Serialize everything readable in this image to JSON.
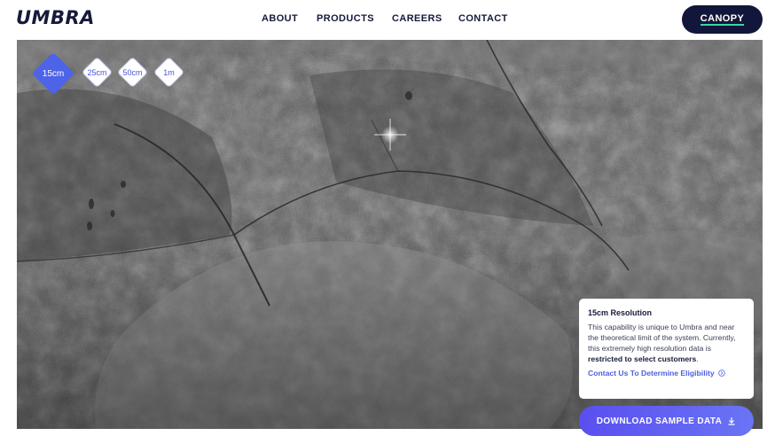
{
  "brand": {
    "logo": "UMBRA"
  },
  "nav": {
    "items": [
      "ABOUT",
      "PRODUCTS",
      "CAREERS",
      "CONTACT"
    ],
    "canopy_button": "CANOPY"
  },
  "resolutions": {
    "options": [
      "15cm",
      "25cm",
      "50cm",
      "1m"
    ],
    "selected": "15cm"
  },
  "info_card": {
    "title": "15cm Resolution",
    "body_before": "This capability is unique to Umbra and near the theoretical limit of the system. Currently, this extremely high resolution data is",
    "body_bold": "restricted to select customers",
    "body_after": ".",
    "link": "Contact Us To Determine Eligibility"
  },
  "download_button": "DOWNLOAD SAMPLE DATA",
  "colors": {
    "brand_navy": "#161a3a",
    "accent_blue": "#4d63e8",
    "accent_green": "#36d6a2"
  }
}
